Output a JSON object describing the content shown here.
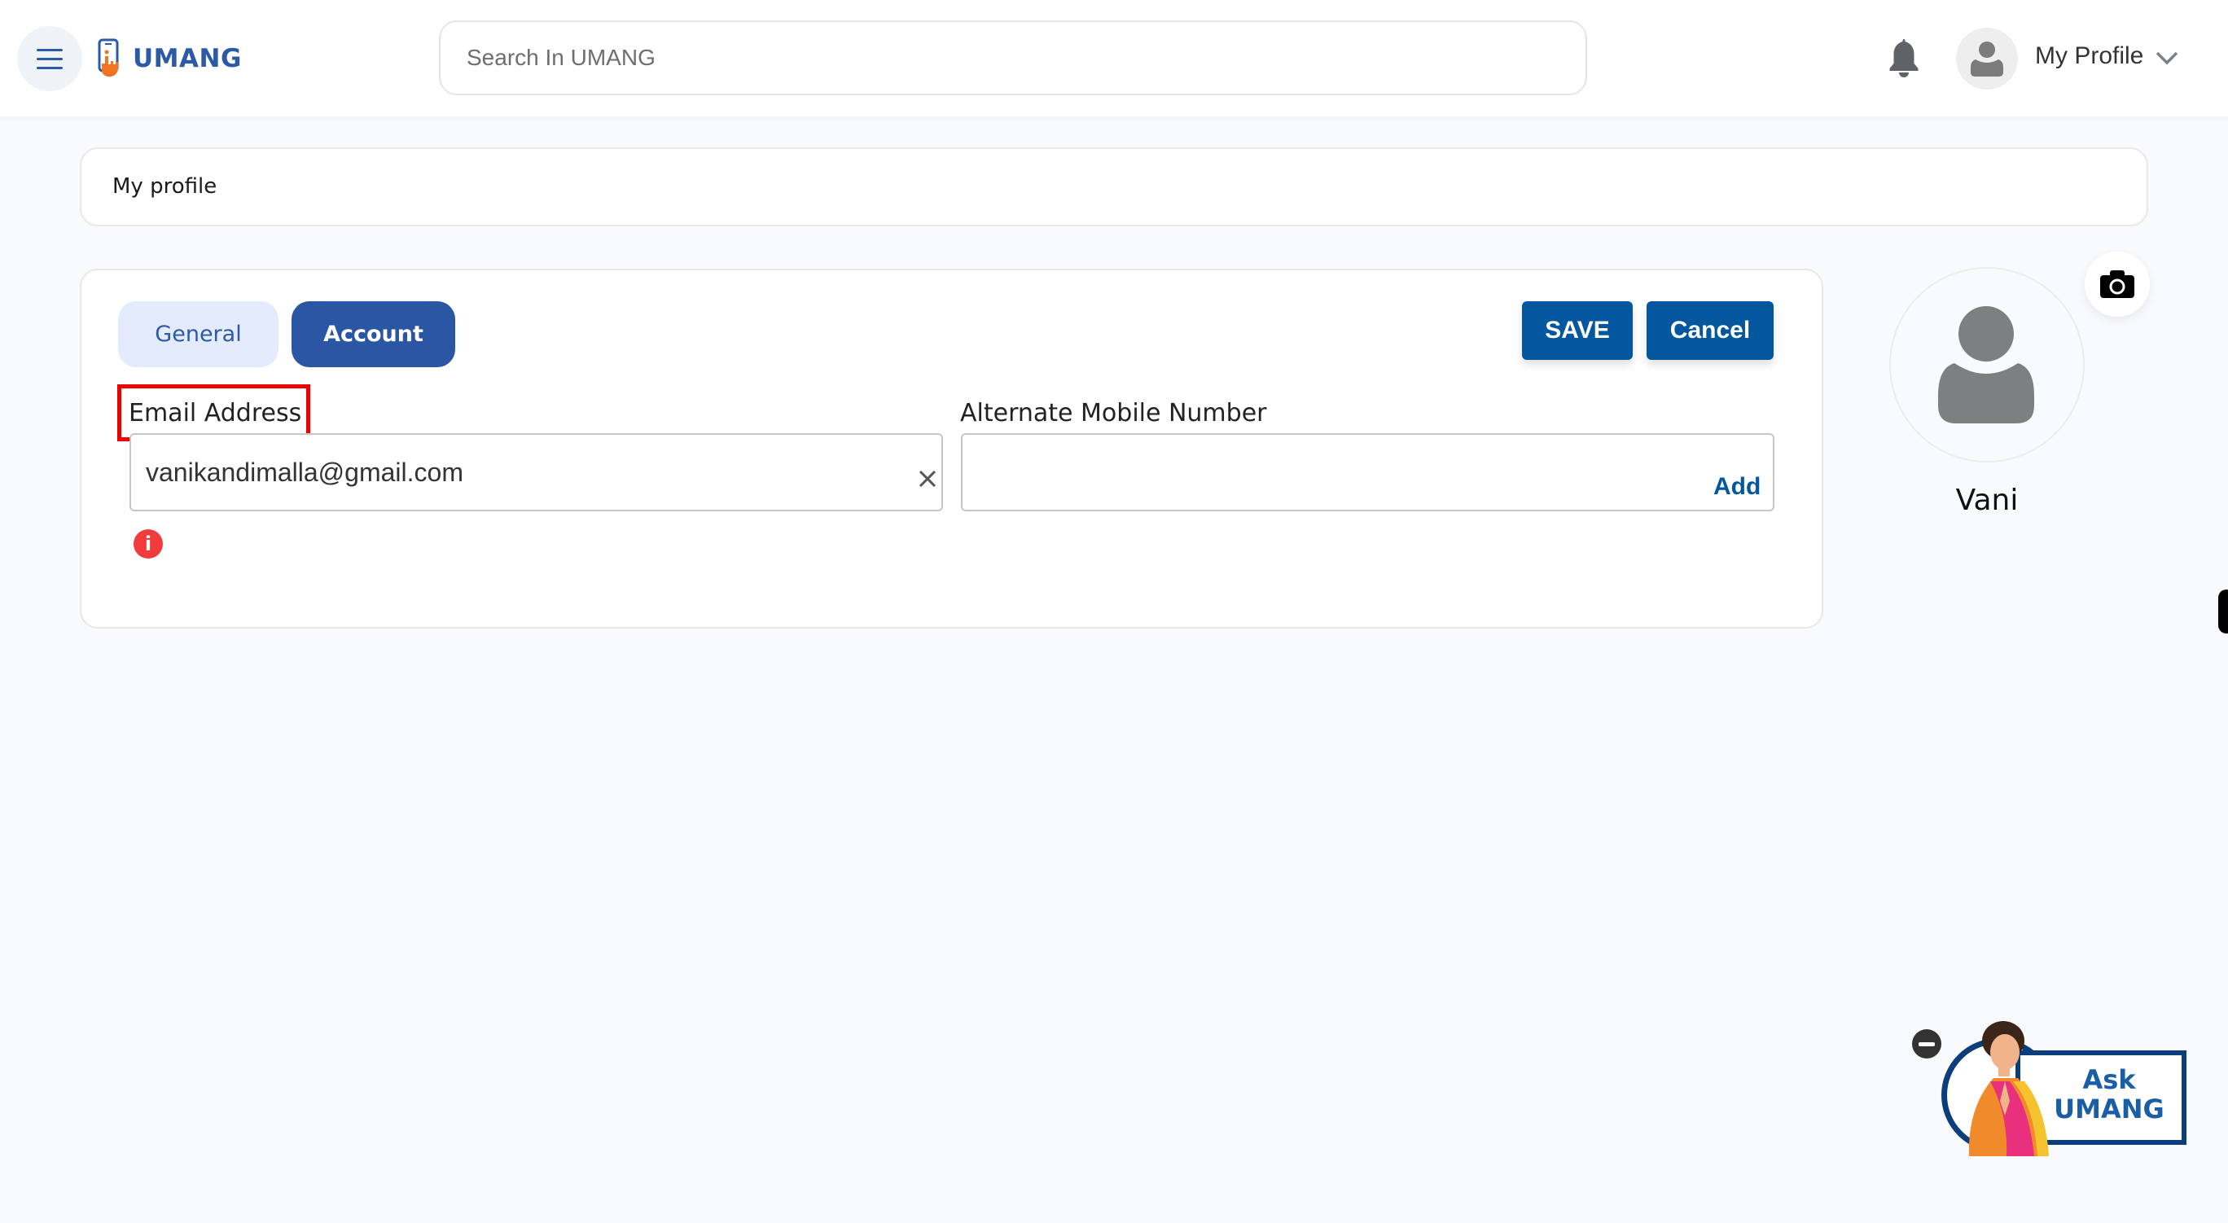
{
  "header": {
    "menu_icon": "hamburger-icon",
    "logo_text": "UMANG",
    "search_placeholder": "Search In UMANG",
    "search_value": "",
    "notification_icon": "bell-icon",
    "profile_label": "My Profile",
    "profile_chevron": "chevron-down-icon"
  },
  "page": {
    "title": "My profile"
  },
  "tabs": [
    {
      "label": "General",
      "active": false
    },
    {
      "label": "Account",
      "active": true
    }
  ],
  "actions": {
    "save_label": "SAVE",
    "cancel_label": "Cancel"
  },
  "form": {
    "email": {
      "label": "Email Address",
      "value": "vanikandimalla@gmail.com",
      "clear_icon": "close-icon",
      "info_icon_glyph": "i",
      "highlighted": true
    },
    "alternate_mobile": {
      "label": "Alternate Mobile Number",
      "value": "",
      "add_label": "Add"
    }
  },
  "profile_side": {
    "name": "Vani",
    "camera_icon": "camera-icon"
  },
  "assistant": {
    "line1": "Ask",
    "line2": "UMANG"
  },
  "colors": {
    "brand_blue": "#2c5aa6",
    "button_blue": "#02579e",
    "highlight_red": "#ee0000",
    "error_red": "#f23b3b",
    "logo_orange": "#f37321"
  }
}
